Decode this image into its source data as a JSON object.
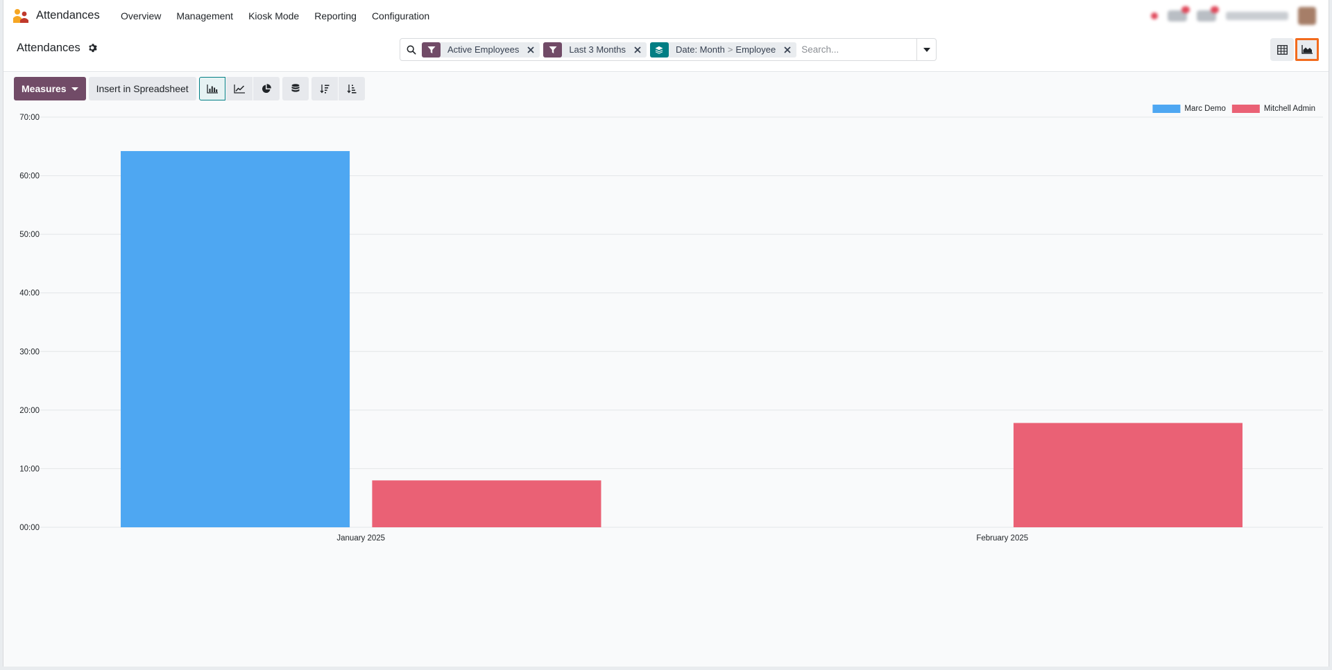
{
  "app": {
    "name": "Attendances",
    "menu": [
      "Overview",
      "Management",
      "Kiosk Mode",
      "Reporting",
      "Configuration"
    ]
  },
  "control": {
    "title": "Attendances",
    "facets": [
      {
        "kind": "filter",
        "label": "Active Employees"
      },
      {
        "kind": "filter",
        "label": "Last 3 Months"
      },
      {
        "kind": "group",
        "label_a": "Date: Month",
        "sep": ">",
        "label_b": "Employee"
      }
    ],
    "search_placeholder": "Search...",
    "views": [
      "pivot-view",
      "graph-view"
    ],
    "active_view": "graph-view"
  },
  "toolbar": {
    "measures_label": "Measures",
    "insert_label": "Insert in Spreadsheet",
    "chart_types": [
      "bar",
      "line",
      "pie"
    ],
    "active_chart_type": "bar"
  },
  "colors": {
    "primary": "#714b67",
    "teal": "#017e84",
    "highlight": "#f26b1d",
    "series_blue": "#4ea7f2",
    "series_red": "#ea6175"
  },
  "chart_data": {
    "type": "bar",
    "categories": [
      "January 2025",
      "February 2025"
    ],
    "series": [
      {
        "name": "Marc Demo",
        "color": "#4ea7f2",
        "values": [
          64.2,
          0
        ]
      },
      {
        "name": "Mitchell Admin",
        "color": "#ea6175",
        "values": [
          8.0,
          17.8
        ]
      }
    ],
    "ylim": [
      0,
      70
    ],
    "yticks": [
      0,
      10,
      20,
      30,
      40,
      50,
      60,
      70
    ],
    "ytick_labels": [
      "00:00",
      "10:00",
      "20:00",
      "30:00",
      "40:00",
      "50:00",
      "60:00",
      "70:00"
    ],
    "grid": true,
    "legend": "top-right"
  }
}
